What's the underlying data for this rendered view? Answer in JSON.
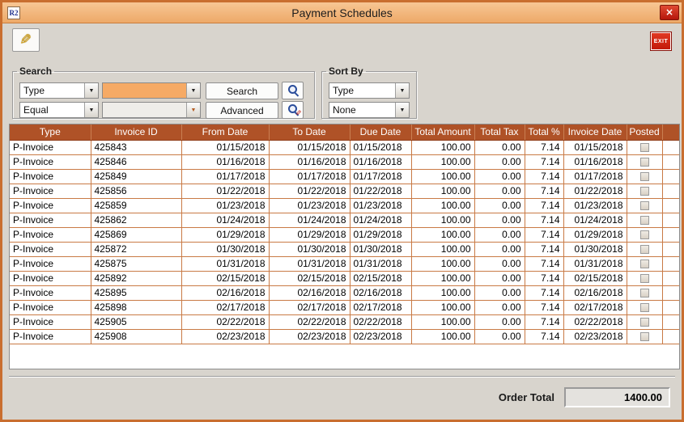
{
  "window": {
    "title": "Payment Schedules",
    "icon_text": "R2",
    "close_glyph": "×"
  },
  "toolbar": {
    "exit_label": "EXIT"
  },
  "icons": {
    "pencil": "✎",
    "dropdown_arrow": "▼",
    "advanced_pencil": "✎"
  },
  "search": {
    "legend": "Search",
    "field_value": "Type",
    "keyword_value": "",
    "operator_value": "Equal",
    "operator_param_value": "",
    "search_label": "Search",
    "advanced_label": "Advanced"
  },
  "sort": {
    "legend": "Sort By",
    "primary_value": "Type",
    "secondary_value": "None"
  },
  "table": {
    "headers": [
      "Type",
      "Invoice ID",
      "From Date",
      "To Date",
      "Due Date",
      "Total Amount",
      "Total Tax",
      "Total %",
      "Invoice Date",
      "Posted"
    ],
    "rows": [
      {
        "type": "P-Invoice",
        "invoice_id": "425843",
        "from_date": "01/15/2018",
        "to_date": "01/15/2018",
        "due_date": "01/15/2018",
        "total_amount": "100.00",
        "total_tax": "0.00",
        "total_pct": "7.14",
        "invoice_date": "01/15/2018",
        "posted": false
      },
      {
        "type": "P-Invoice",
        "invoice_id": "425846",
        "from_date": "01/16/2018",
        "to_date": "01/16/2018",
        "due_date": "01/16/2018",
        "total_amount": "100.00",
        "total_tax": "0.00",
        "total_pct": "7.14",
        "invoice_date": "01/16/2018",
        "posted": false
      },
      {
        "type": "P-Invoice",
        "invoice_id": "425849",
        "from_date": "01/17/2018",
        "to_date": "01/17/2018",
        "due_date": "01/17/2018",
        "total_amount": "100.00",
        "total_tax": "0.00",
        "total_pct": "7.14",
        "invoice_date": "01/17/2018",
        "posted": false
      },
      {
        "type": "P-Invoice",
        "invoice_id": "425856",
        "from_date": "01/22/2018",
        "to_date": "01/22/2018",
        "due_date": "01/22/2018",
        "total_amount": "100.00",
        "total_tax": "0.00",
        "total_pct": "7.14",
        "invoice_date": "01/22/2018",
        "posted": false
      },
      {
        "type": "P-Invoice",
        "invoice_id": "425859",
        "from_date": "01/23/2018",
        "to_date": "01/23/2018",
        "due_date": "01/23/2018",
        "total_amount": "100.00",
        "total_tax": "0.00",
        "total_pct": "7.14",
        "invoice_date": "01/23/2018",
        "posted": false
      },
      {
        "type": "P-Invoice",
        "invoice_id": "425862",
        "from_date": "01/24/2018",
        "to_date": "01/24/2018",
        "due_date": "01/24/2018",
        "total_amount": "100.00",
        "total_tax": "0.00",
        "total_pct": "7.14",
        "invoice_date": "01/24/2018",
        "posted": false
      },
      {
        "type": "P-Invoice",
        "invoice_id": "425869",
        "from_date": "01/29/2018",
        "to_date": "01/29/2018",
        "due_date": "01/29/2018",
        "total_amount": "100.00",
        "total_tax": "0.00",
        "total_pct": "7.14",
        "invoice_date": "01/29/2018",
        "posted": false
      },
      {
        "type": "P-Invoice",
        "invoice_id": "425872",
        "from_date": "01/30/2018",
        "to_date": "01/30/2018",
        "due_date": "01/30/2018",
        "total_amount": "100.00",
        "total_tax": "0.00",
        "total_pct": "7.14",
        "invoice_date": "01/30/2018",
        "posted": false
      },
      {
        "type": "P-Invoice",
        "invoice_id": "425875",
        "from_date": "01/31/2018",
        "to_date": "01/31/2018",
        "due_date": "01/31/2018",
        "total_amount": "100.00",
        "total_tax": "0.00",
        "total_pct": "7.14",
        "invoice_date": "01/31/2018",
        "posted": false
      },
      {
        "type": "P-Invoice",
        "invoice_id": "425892",
        "from_date": "02/15/2018",
        "to_date": "02/15/2018",
        "due_date": "02/15/2018",
        "total_amount": "100.00",
        "total_tax": "0.00",
        "total_pct": "7.14",
        "invoice_date": "02/15/2018",
        "posted": false
      },
      {
        "type": "P-Invoice",
        "invoice_id": "425895",
        "from_date": "02/16/2018",
        "to_date": "02/16/2018",
        "due_date": "02/16/2018",
        "total_amount": "100.00",
        "total_tax": "0.00",
        "total_pct": "7.14",
        "invoice_date": "02/16/2018",
        "posted": false
      },
      {
        "type": "P-Invoice",
        "invoice_id": "425898",
        "from_date": "02/17/2018",
        "to_date": "02/17/2018",
        "due_date": "02/17/2018",
        "total_amount": "100.00",
        "total_tax": "0.00",
        "total_pct": "7.14",
        "invoice_date": "02/17/2018",
        "posted": false
      },
      {
        "type": "P-Invoice",
        "invoice_id": "425905",
        "from_date": "02/22/2018",
        "to_date": "02/22/2018",
        "due_date": "02/22/2018",
        "total_amount": "100.00",
        "total_tax": "0.00",
        "total_pct": "7.14",
        "invoice_date": "02/22/2018",
        "posted": false
      },
      {
        "type": "P-Invoice",
        "invoice_id": "425908",
        "from_date": "02/23/2018",
        "to_date": "02/23/2018",
        "due_date": "02/23/2018",
        "total_amount": "100.00",
        "total_tax": "0.00",
        "total_pct": "7.14",
        "invoice_date": "02/23/2018",
        "posted": false
      }
    ]
  },
  "footer": {
    "order_total_label": "Order Total",
    "order_total_value": "1400.00"
  },
  "colors": {
    "titlebar": "#F2B57E",
    "window_border": "#C96E2F",
    "header_bg": "#AF5227",
    "grid_line": "#C97A45",
    "search_highlight": "#F6AA65",
    "exit_red": "#D62B1E"
  }
}
